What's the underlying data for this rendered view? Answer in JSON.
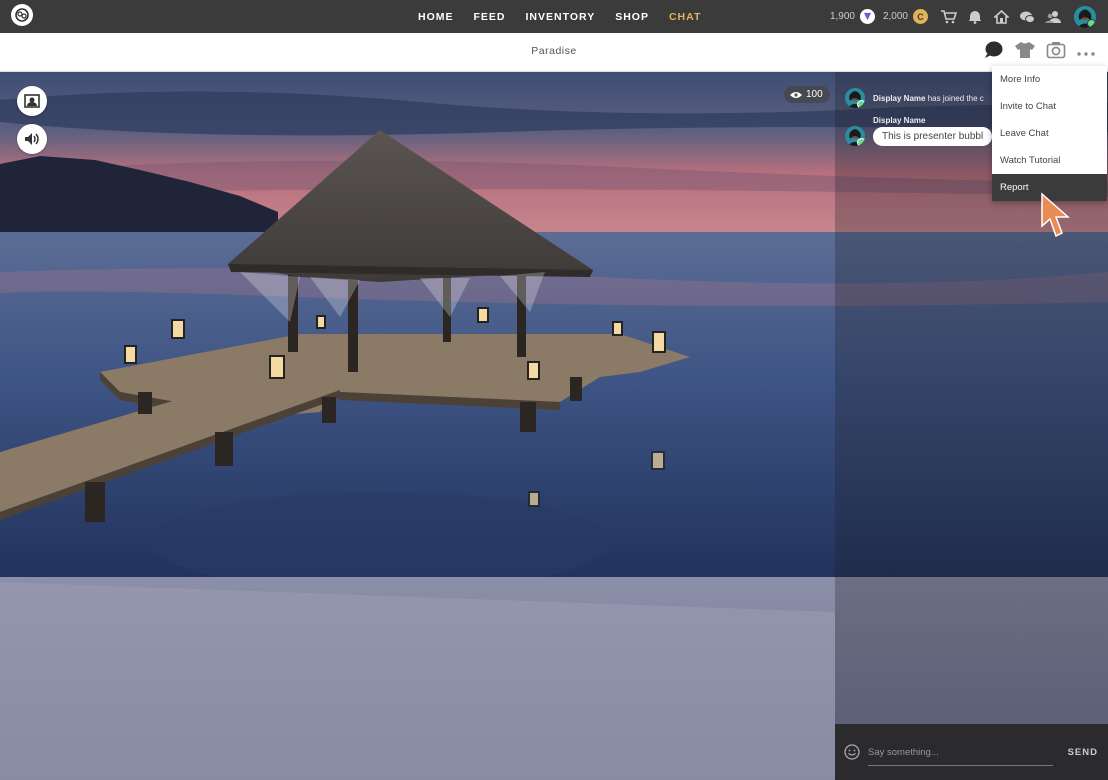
{
  "nav": {
    "items": [
      {
        "label": "HOME"
      },
      {
        "label": "FEED"
      },
      {
        "label": "INVENTORY"
      },
      {
        "label": "SHOP"
      },
      {
        "label": "CHAT"
      }
    ]
  },
  "currency": {
    "vcoin": "1,900",
    "credits": "2,000",
    "credit_symbol": "C"
  },
  "room": {
    "title": "Paradise",
    "viewers": "100"
  },
  "chat": {
    "messages": [
      {
        "name": "Display Name",
        "text": "has joined the c"
      },
      {
        "name": "Display Name",
        "text": "This is  presenter bubbl"
      }
    ],
    "input_placeholder": "Say something...",
    "send_label": "SEND"
  },
  "menu": {
    "items": [
      {
        "label": "More Info"
      },
      {
        "label": "Invite to Chat"
      },
      {
        "label": "Leave Chat"
      },
      {
        "label": "Watch Tutorial"
      },
      {
        "label": "Report"
      }
    ]
  },
  "colors": {
    "accent": "#e2b25a",
    "topbar": "#3b3b3b",
    "online": "#6ddc8a",
    "cursor": "#e88b55"
  }
}
